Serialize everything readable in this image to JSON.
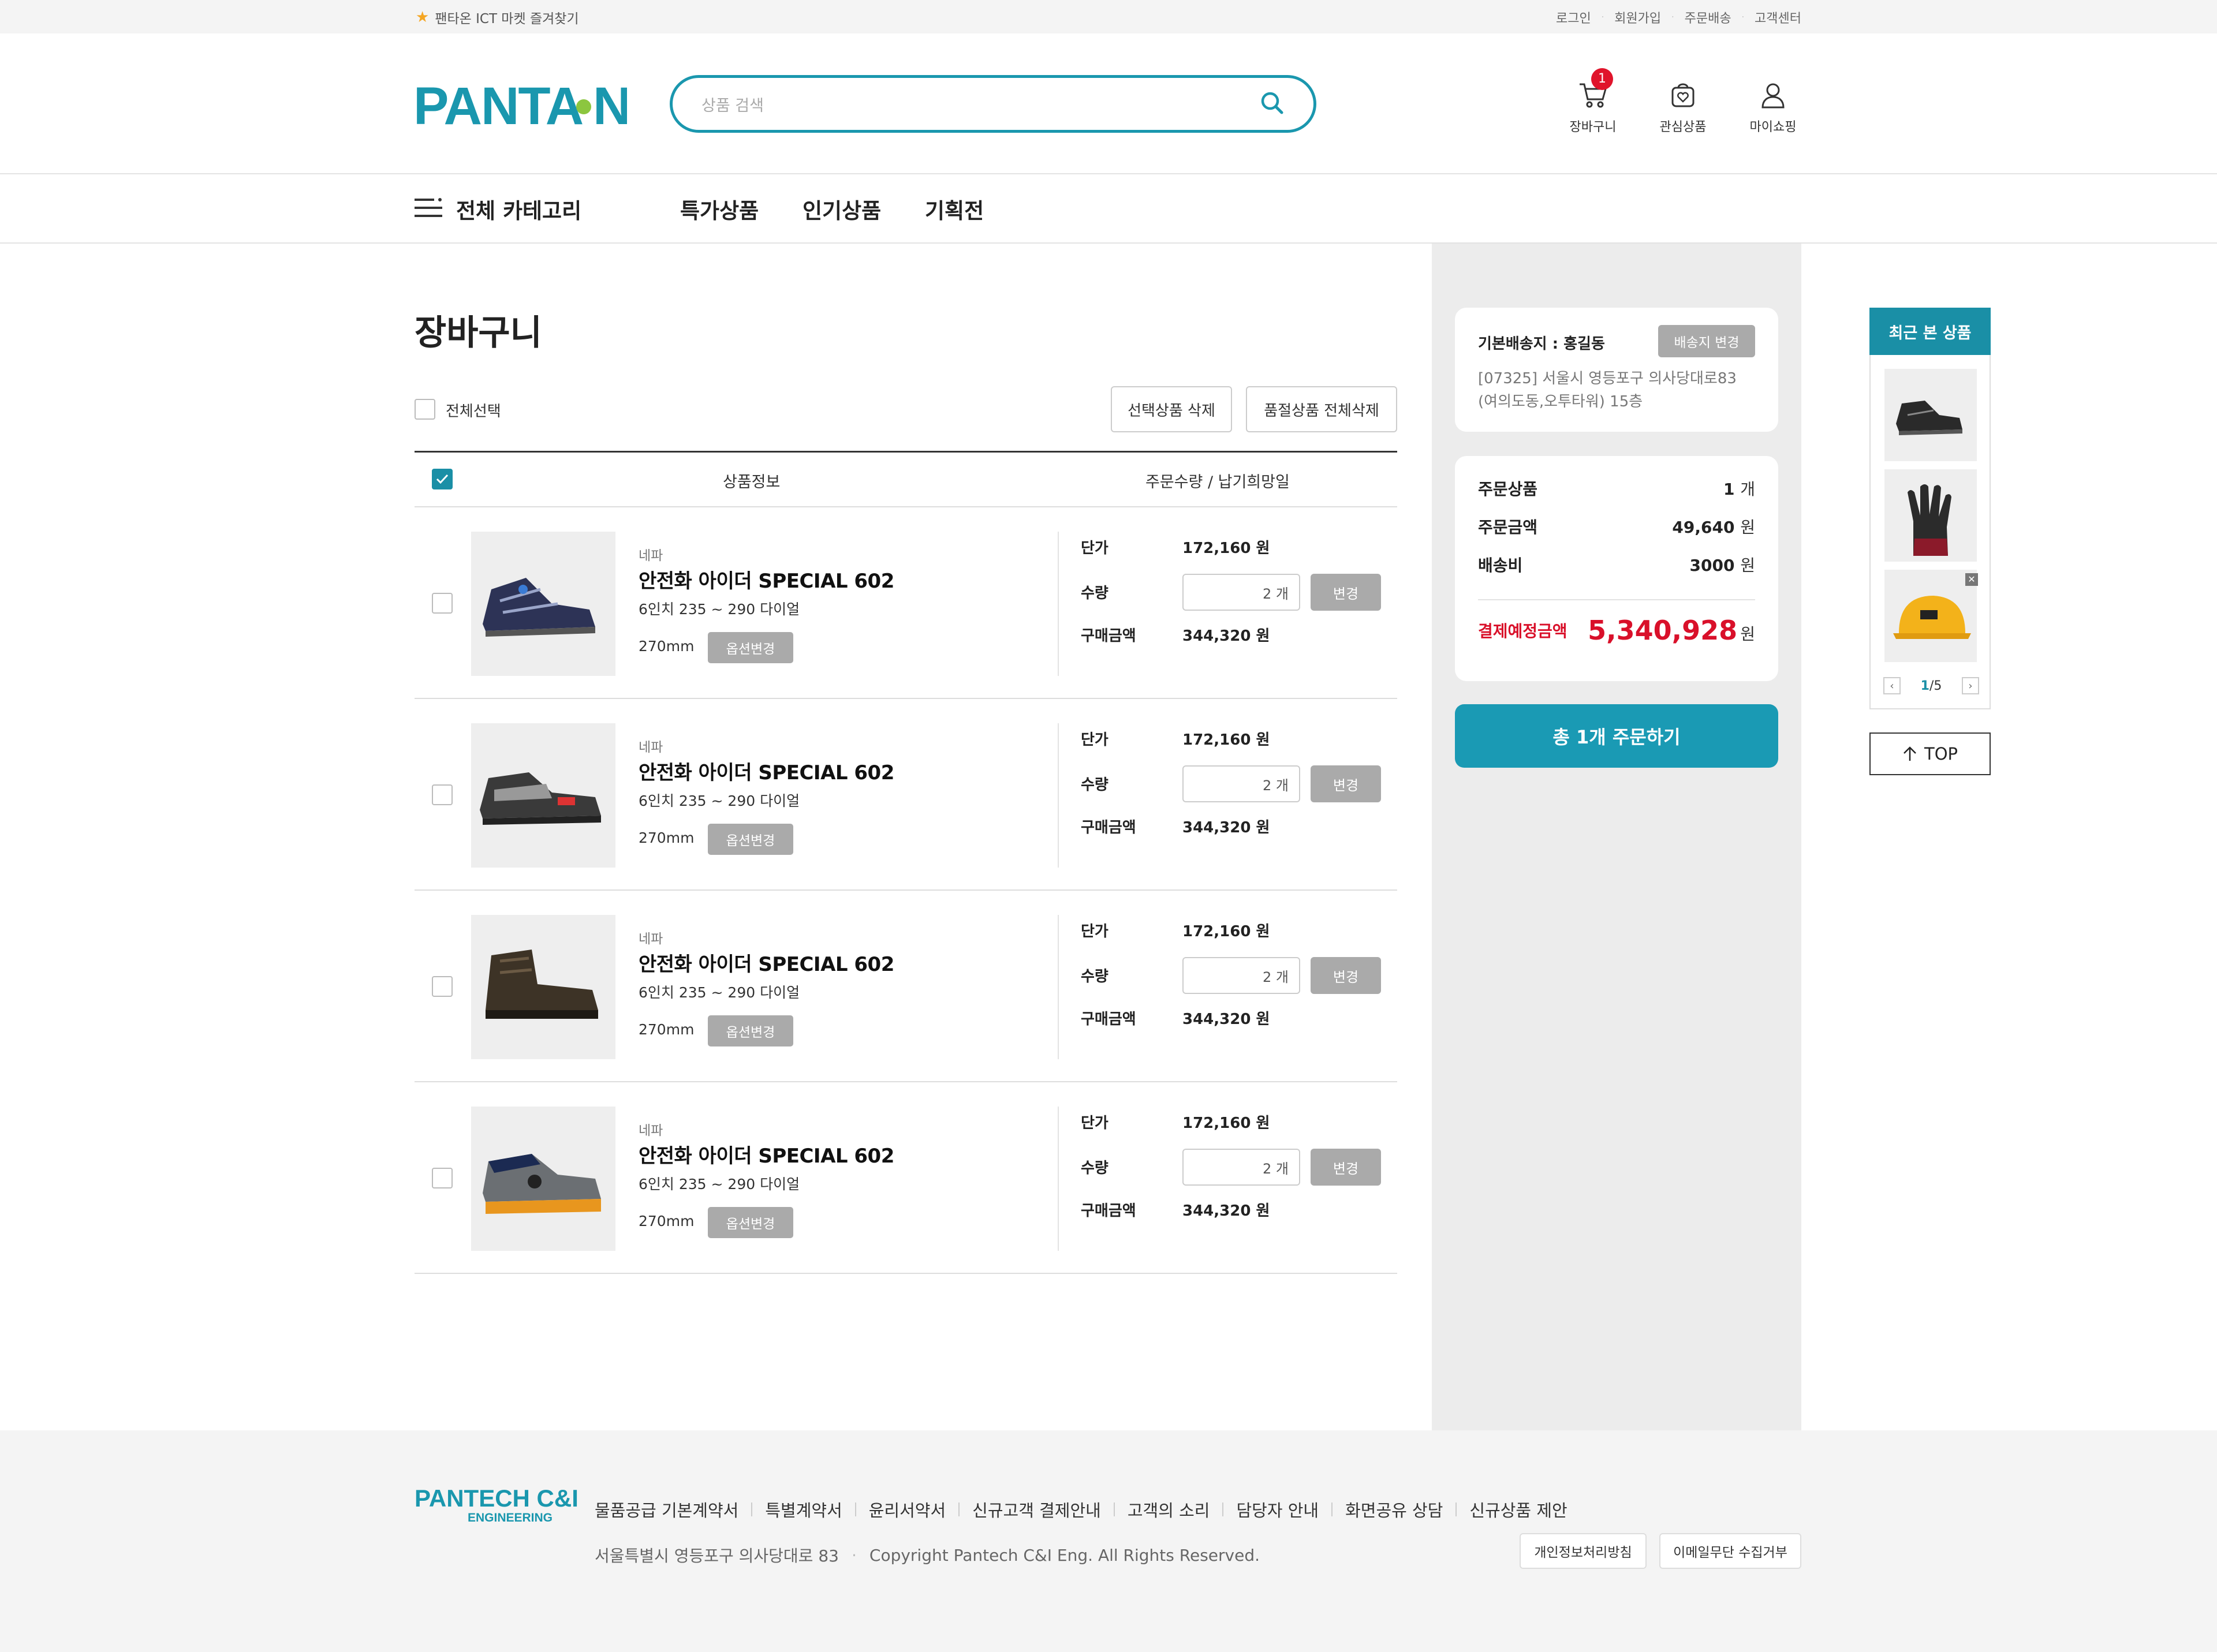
{
  "topbar": {
    "favorite": "팬타온 ICT 마켓 즐겨찾기",
    "links": [
      "로그인",
      "회원가입",
      "주문배송",
      "고객센터"
    ]
  },
  "header": {
    "logo": "PANTAON",
    "search_placeholder": "상품 검색",
    "icons": [
      {
        "label": "장바구니",
        "icon": "cart-icon",
        "badge": "1"
      },
      {
        "label": "관심상품",
        "icon": "heart-bag-icon"
      },
      {
        "label": "마이쇼핑",
        "icon": "user-icon"
      }
    ]
  },
  "nav": {
    "all_category": "전체 카테고리",
    "items": [
      "특가상품",
      "인기상품",
      "기획전"
    ]
  },
  "cart": {
    "title": "장바구니",
    "select_all": "전체선택",
    "delete_selected": "선택상품 삭제",
    "delete_soldout": "품절상품 전체삭제",
    "header_info": "상품정보",
    "header_qty": "주문수량 / 납기희망일",
    "labels": {
      "unit_price": "단가",
      "qty": "수량",
      "total": "구매금액",
      "change": "변경",
      "option_change": "옵션변경"
    },
    "items": [
      {
        "brand": "네파",
        "name": "안전화 아이더 SPECIAL 602",
        "desc": "6인치 235 ~ 290 다이얼",
        "size": "270mm",
        "unit_price": "172,160 원",
        "qty": "2 개",
        "total": "344,320 원",
        "image": "shoe-navy"
      },
      {
        "brand": "네파",
        "name": "안전화 아이더 SPECIAL 602",
        "desc": "6인치 235 ~ 290 다이얼",
        "size": "270mm",
        "unit_price": "172,160 원",
        "qty": "2 개",
        "total": "344,320 원",
        "image": "shoe-grey-black"
      },
      {
        "brand": "네파",
        "name": "안전화 아이더 SPECIAL 602",
        "desc": "6인치 235 ~ 290 다이얼",
        "size": "270mm",
        "unit_price": "172,160 원",
        "qty": "2 개",
        "total": "344,320 원",
        "image": "boot-brown"
      },
      {
        "brand": "네파",
        "name": "안전화 아이더 SPECIAL 602",
        "desc": "6인치 235 ~ 290 다이얼",
        "size": "270mm",
        "unit_price": "172,160 원",
        "qty": "2 개",
        "total": "344,320 원",
        "image": "shoe-grey-orange"
      }
    ]
  },
  "address": {
    "title": "기본배송지 : 홍길동",
    "change": "배송지 변경",
    "line1": "[07325] 서울시 영등포구 의사당대로83",
    "line2": "(여의도동,오투타워) 15층"
  },
  "summary": {
    "items_label": "주문상품",
    "items_value": "1",
    "items_unit": "개",
    "amount_label": "주문금액",
    "amount_value": "49,640",
    "amount_unit": "원",
    "ship_label": "배송비",
    "ship_value": "3000",
    "ship_unit": "원",
    "total_label": "결제예정금액",
    "total_value": "5,340,928",
    "total_unit": "원"
  },
  "order_button": "총 1개 주문하기",
  "recent": {
    "title": "최근 본 상품",
    "page_current": "1",
    "page_total": "/5",
    "items": [
      "shoe-black",
      "glove-red",
      "helmet-yellow"
    ]
  },
  "top_button": "TOP",
  "footer": {
    "logo_main": "PANTECH C&I",
    "logo_sub": "ENGINEERING",
    "links": [
      "물품공급 기본계약서",
      "특별계약서",
      "윤리서약서",
      "신규고객 결제안내",
      "고객의 소리",
      "담당자 안내",
      "화면공유 상담",
      "신규상품 제안"
    ],
    "address": "서울특별시 영등포구 의사당대로 83",
    "copyright": "Copyright Pantech C&I Eng. All Rights Reserved.",
    "btn_privacy": "개인정보처리방침",
    "btn_email": "이메일무단 수집거부"
  },
  "colors": {
    "accent": "#1a97ae",
    "red": "#d9102a",
    "grey_button": "#aaaaaa"
  }
}
